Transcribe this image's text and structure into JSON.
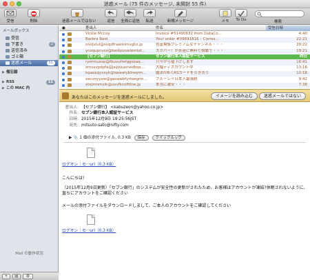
{
  "window": {
    "title": "迷惑メール (75 件のメッセージ, 未開封 55 件)"
  },
  "toolbar": {
    "items": [
      {
        "label": "受信"
      },
      {
        "label": "削除"
      },
      {
        "label": "迷惑メールではない"
      },
      {
        "label": "返信"
      },
      {
        "label": "全員に返信"
      },
      {
        "label": "転送"
      },
      {
        "label": "新規メッセージ"
      },
      {
        "label": "メモ"
      },
      {
        "label": "To Do"
      }
    ],
    "search_label": "検索"
  },
  "sidebar": {
    "section": "メールボックス",
    "items": [
      {
        "label": "受信",
        "badge": ""
      },
      {
        "label": "下書き",
        "badge": "2"
      },
      {
        "label": "送信済み",
        "badge": ""
      },
      {
        "label": "ゴミ箱",
        "badge": ""
      },
      {
        "label": "迷惑メール",
        "badge": "55"
      }
    ],
    "groups": [
      {
        "label": "備忘録"
      },
      {
        "label": "RSS",
        "badge": "11"
      },
      {
        "label": "この MAC 内"
      }
    ],
    "activity": "Mail の動作状況"
  },
  "list": {
    "columns": {
      "from": "差出人",
      "subject": "件名",
      "date": "受信日時"
    },
    "rows": [
      {
        "from": "Vickie Mccoy",
        "subject": "Invoice #51490632 from DataCo...",
        "date": "4:40"
      },
      {
        "from": "Barbra Reid",
        "subject": "Your order #09691816 – Corres...",
        "date": "22:21"
      },
      {
        "from": "oivqvlul@svqdfraemimvghz.jp",
        "subject": "吉富貴族プレミアムなチャンネル・・・",
        "date": "20:22"
      },
      {
        "from": "ynzqupcvxx@bedipvswlemtsf...",
        "subject": "スカパー！が永遠に無料で視聴で・・・",
        "date": "19:21"
      },
      {
        "from": "【セブン銀行】",
        "subject": "セブン銀行本人認証サービス",
        "date": "昨日",
        "selected": true
      },
      {
        "from": "ryermuosp@fbuvufiefggsbaq...",
        "subject": "只今から値下げします",
        "date": "16:41"
      },
      {
        "from": "zmsxvpdpfa@jayoxuonedbqs...",
        "subject": "大幅ディスカウント中",
        "date": "13:16"
      },
      {
        "from": "kqaoxqyxxyk@oawatyblreqrm...",
        "subject": "魔法のB-CASカードを引き売り",
        "date": "10:18"
      },
      {
        "from": "oecvsyyxw@gaoawbfyrtoegrm...",
        "subject": "ブルーレイ日本人最強説",
        "date": "9:42"
      },
      {
        "from": "xtxjmnmxik@uxvfkcofitine.jp",
        "subject": "本当に激安・・・",
        "date": "7:38"
      }
    ]
  },
  "junk": {
    "message": "あなたはこのメッセージを迷惑メールにしました。",
    "load_images": "イメージを読み込む",
    "not_junk": "迷惑メールではない"
  },
  "message": {
    "from_label": "差出人:",
    "from": "【セブン銀行】 <kabuzeon@yahoo.co.jp>",
    "subject_label": "件名:",
    "subject": "セブン銀行本人認証サービス",
    "date_label": "日時:",
    "date": "2015年12月9日 19:25:56JST",
    "to_label": "宛先:",
    "to": "mitsuto-sato@nifty.com",
    "attachment_summary": "1 個の添付ファイル, 0.3 KB",
    "save_label": "保存",
    "quicklook_label": "クイックルック",
    "attachment_name": "ログオン｜セ···url（0.3 KB）",
    "body": [
      "こんにちは！",
      "（2015年12月9日更新）「セブン銀行」のシステムが安全性の更新がされたため、お客様はアカウントが凍結?休眠されないように、直ちにアカウントをご確認ください",
      "メールの添付ファイルをダウンロードしまして、ご本人のアカウントをご確認してください"
    ],
    "inline_attachment_name": "ログオン｜セ···url（0.3 KB）"
  }
}
